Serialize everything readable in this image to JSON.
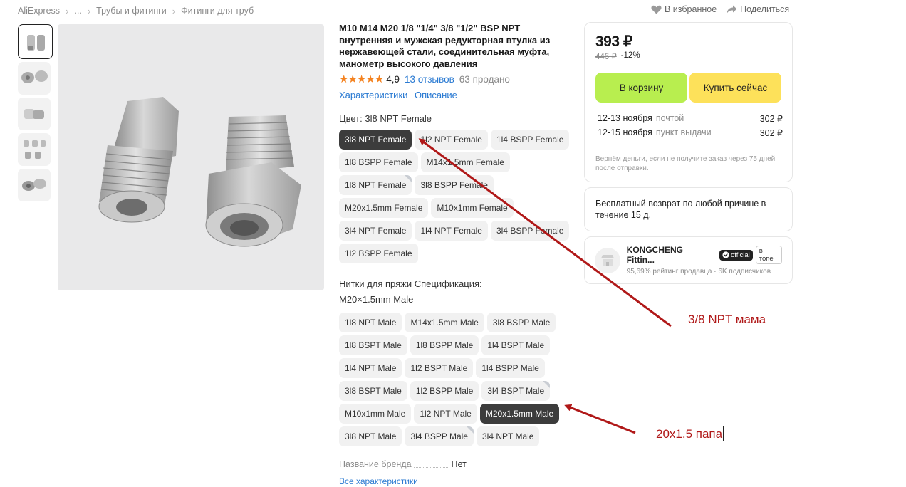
{
  "breadcrumbs": [
    "AliExpress",
    "...",
    "Трубы и фитинги",
    "Фитинги для труб"
  ],
  "top_actions": {
    "favorite": "В избранное",
    "share": "Поделиться"
  },
  "product": {
    "title": "M10 M14 M20 1/8 \"1/4\" 3/8 \"1/2\" BSP NPT внутренняя и мужская редукторная втулка из нержавеющей стали, соединительная муфта, манометр высокого давления",
    "rating": "4,9",
    "stars": 5,
    "reviews": "13 отзывов",
    "sold": "63 продано",
    "links": [
      "Характеристики",
      "Описание"
    ]
  },
  "color_option": {
    "label": "Цвет: 3l8 NPT Female",
    "chips": [
      {
        "label": "3l8 NPT Female",
        "selected": true
      },
      {
        "label": "1l2 NPT Female"
      },
      {
        "label": "1l4 BSPP Female"
      },
      {
        "label": "1l8 BSPP Female"
      },
      {
        "label": "M14x1.5mm Female"
      },
      {
        "label": "1l8 NPT Female",
        "corner": true
      },
      {
        "label": "3l8 BSPP Female"
      },
      {
        "label": "M20x1.5mm Female"
      },
      {
        "label": "M10x1mm Female"
      },
      {
        "label": "3l4 NPT Female"
      },
      {
        "label": "1l4 NPT Female"
      },
      {
        "label": "3l4 BSPP Female"
      },
      {
        "label": "1l2 BSPP Female"
      }
    ]
  },
  "thread_option": {
    "label_line1": "Нитки для пряжи Спецификация:",
    "label_line2": "M20×1.5mm Male",
    "chips": [
      {
        "label": "1l8 NPT Male"
      },
      {
        "label": "M14x1.5mm Male"
      },
      {
        "label": "3l8 BSPP Male"
      },
      {
        "label": "1l8 BSPT Male"
      },
      {
        "label": "1l8 BSPP Male"
      },
      {
        "label": "1l4 BSPT Male"
      },
      {
        "label": "1l4 NPT Male"
      },
      {
        "label": "1l2 BSPT Male"
      },
      {
        "label": "1l4 BSPP Male"
      },
      {
        "label": "3l8 BSPT Male"
      },
      {
        "label": "1l2 BSPP Male"
      },
      {
        "label": "3l4 BSPT Male",
        "corner": true
      },
      {
        "label": "M10x1mm Male"
      },
      {
        "label": "1l2 NPT Male"
      },
      {
        "label": "M20x1.5mm Male",
        "selected": true
      },
      {
        "label": "3l8 NPT Male"
      },
      {
        "label": "3l4 BSPP Male",
        "corner": true
      },
      {
        "label": "3l4 NPT Male"
      }
    ]
  },
  "brand": {
    "key": "Название бренда",
    "value": "Нет"
  },
  "all_characteristics": "Все характеристики",
  "buy_box": {
    "price": "393 ₽",
    "old_price": "446 ₽",
    "discount": "-12%",
    "cart_button": "В корзину",
    "buy_button": "Купить сейчас",
    "shipping": [
      {
        "date": "12-13 ноября",
        "method": "почтой",
        "price": "302 ₽"
      },
      {
        "date": "12-15 ноября",
        "method": "пункт выдачи",
        "price": "302 ₽"
      }
    ],
    "refund_note": "Вернём деньги, если не получите заказ через 75 дней после отправки."
  },
  "return_box": {
    "text": "Бесплатный возврат по любой причине в течение 15 д."
  },
  "seller": {
    "name": "KONGCHENG Fittin...",
    "official_badge": "official",
    "top_badge": "в топе",
    "rating": "95,69% рейтинг продавца",
    "followers": "6K подписчиков"
  },
  "annotations": {
    "female": "3/8 NPT мама",
    "male": "20x1.5 папа"
  },
  "colors": {
    "accent_link": "#2a7ad2",
    "annotation": "#b01818",
    "cart_btn": "#b8ee4f",
    "buy_btn": "#fde15a"
  }
}
